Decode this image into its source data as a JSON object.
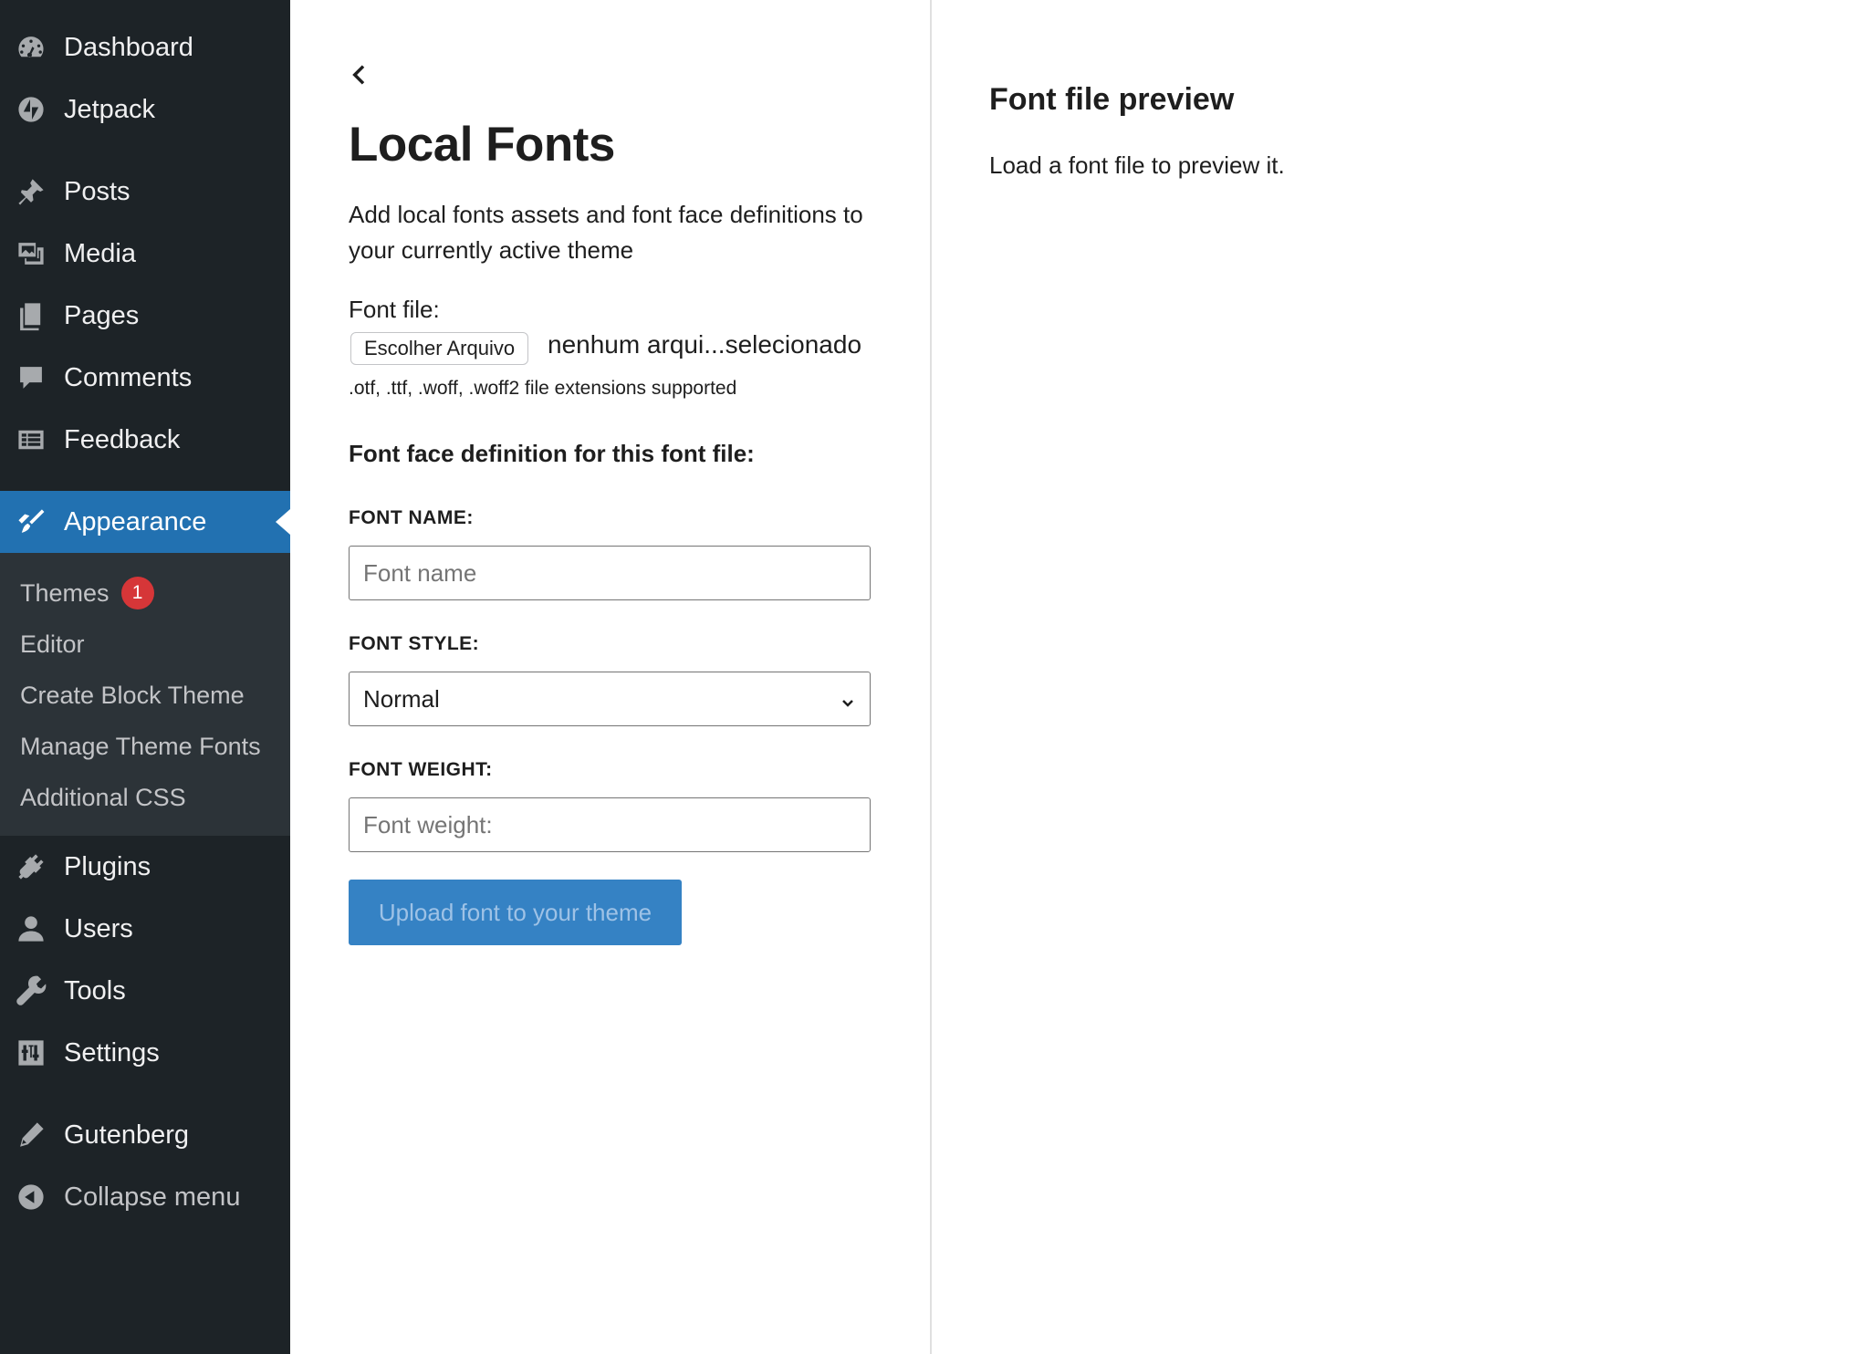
{
  "sidebar": {
    "items_top": [
      {
        "label": "Dashboard",
        "icon": "dashboard-icon"
      },
      {
        "label": "Jetpack",
        "icon": "jetpack-icon"
      },
      {
        "label": "Posts",
        "icon": "pin-icon"
      },
      {
        "label": "Media",
        "icon": "media-icon"
      },
      {
        "label": "Pages",
        "icon": "pages-icon"
      },
      {
        "label": "Comments",
        "icon": "comment-bubble-icon"
      },
      {
        "label": "Feedback",
        "icon": "feedback-form-icon"
      }
    ],
    "active_item": {
      "label": "Appearance",
      "icon": "paintbrush-icon"
    },
    "submenu": [
      {
        "label": "Themes",
        "badge": "1"
      },
      {
        "label": "Editor"
      },
      {
        "label": "Create Block Theme"
      },
      {
        "label": "Manage Theme Fonts"
      },
      {
        "label": "Additional CSS"
      }
    ],
    "items_bottom": [
      {
        "label": "Plugins",
        "icon": "plug-icon"
      },
      {
        "label": "Users",
        "icon": "user-icon"
      },
      {
        "label": "Tools",
        "icon": "wrench-icon"
      },
      {
        "label": "Settings",
        "icon": "sliders-icon"
      },
      {
        "label": "Gutenberg",
        "icon": "pencil-icon"
      },
      {
        "label": "Collapse menu",
        "icon": "collapse-arrow-icon"
      }
    ],
    "colors": {
      "background": "#1d2327",
      "active": "#2271b1",
      "submenu_bg": "#2c3338",
      "badge": "#d63638"
    }
  },
  "main": {
    "back_icon": "chevron-left-icon",
    "title": "Local Fonts",
    "description": "Add local fonts assets and font face definitions to your currently active theme",
    "font_file_label": "Font file:",
    "file_button_label": "Escolher Arquivo",
    "file_status": "nenhum arqui...selecionado",
    "extensions_note": ".otf, .ttf, .woff, .woff2 file extensions supported",
    "section_title": "Font face definition for this font file:",
    "font_name": {
      "label": "FONT NAME:",
      "placeholder": "Font name",
      "value": ""
    },
    "font_style": {
      "label": "FONT STYLE:",
      "value": "Normal"
    },
    "font_weight": {
      "label": "FONT WEIGHT:",
      "placeholder": "Font weight:",
      "value": ""
    },
    "upload_button_label": "Upload font to your theme"
  },
  "preview": {
    "title": "Font file preview",
    "text": "Load a font file to preview it."
  }
}
